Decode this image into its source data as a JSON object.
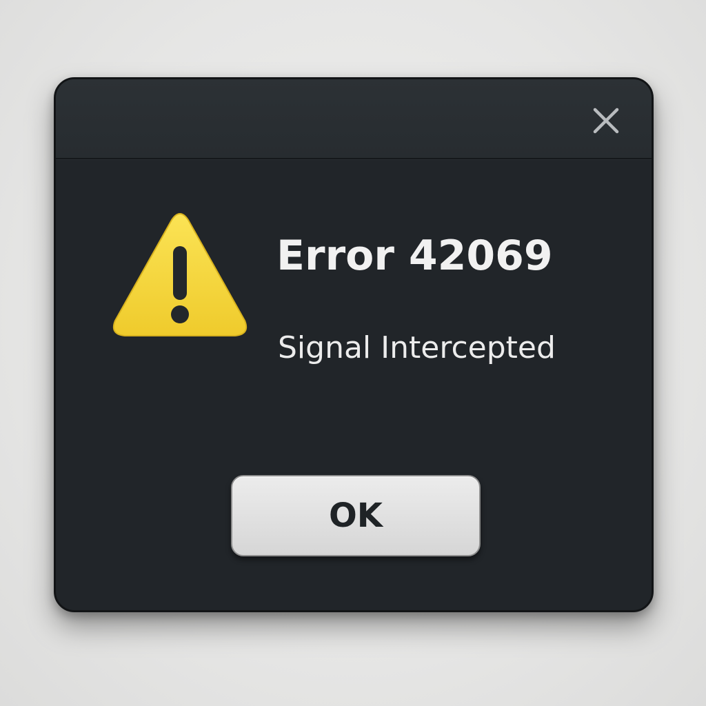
{
  "dialog": {
    "title": "Error 42069",
    "message": "Signal Intercepted",
    "icons": {
      "warning": "warning-triangle-icon",
      "close": "close-icon"
    },
    "ok_label": "OK"
  },
  "colors": {
    "dialog_background": "#212529",
    "titlebar_background": "#2a2f33",
    "warning_yellow": "#f6d93c",
    "button_background": "#e0e0e0",
    "text": "#f1f1f1"
  }
}
